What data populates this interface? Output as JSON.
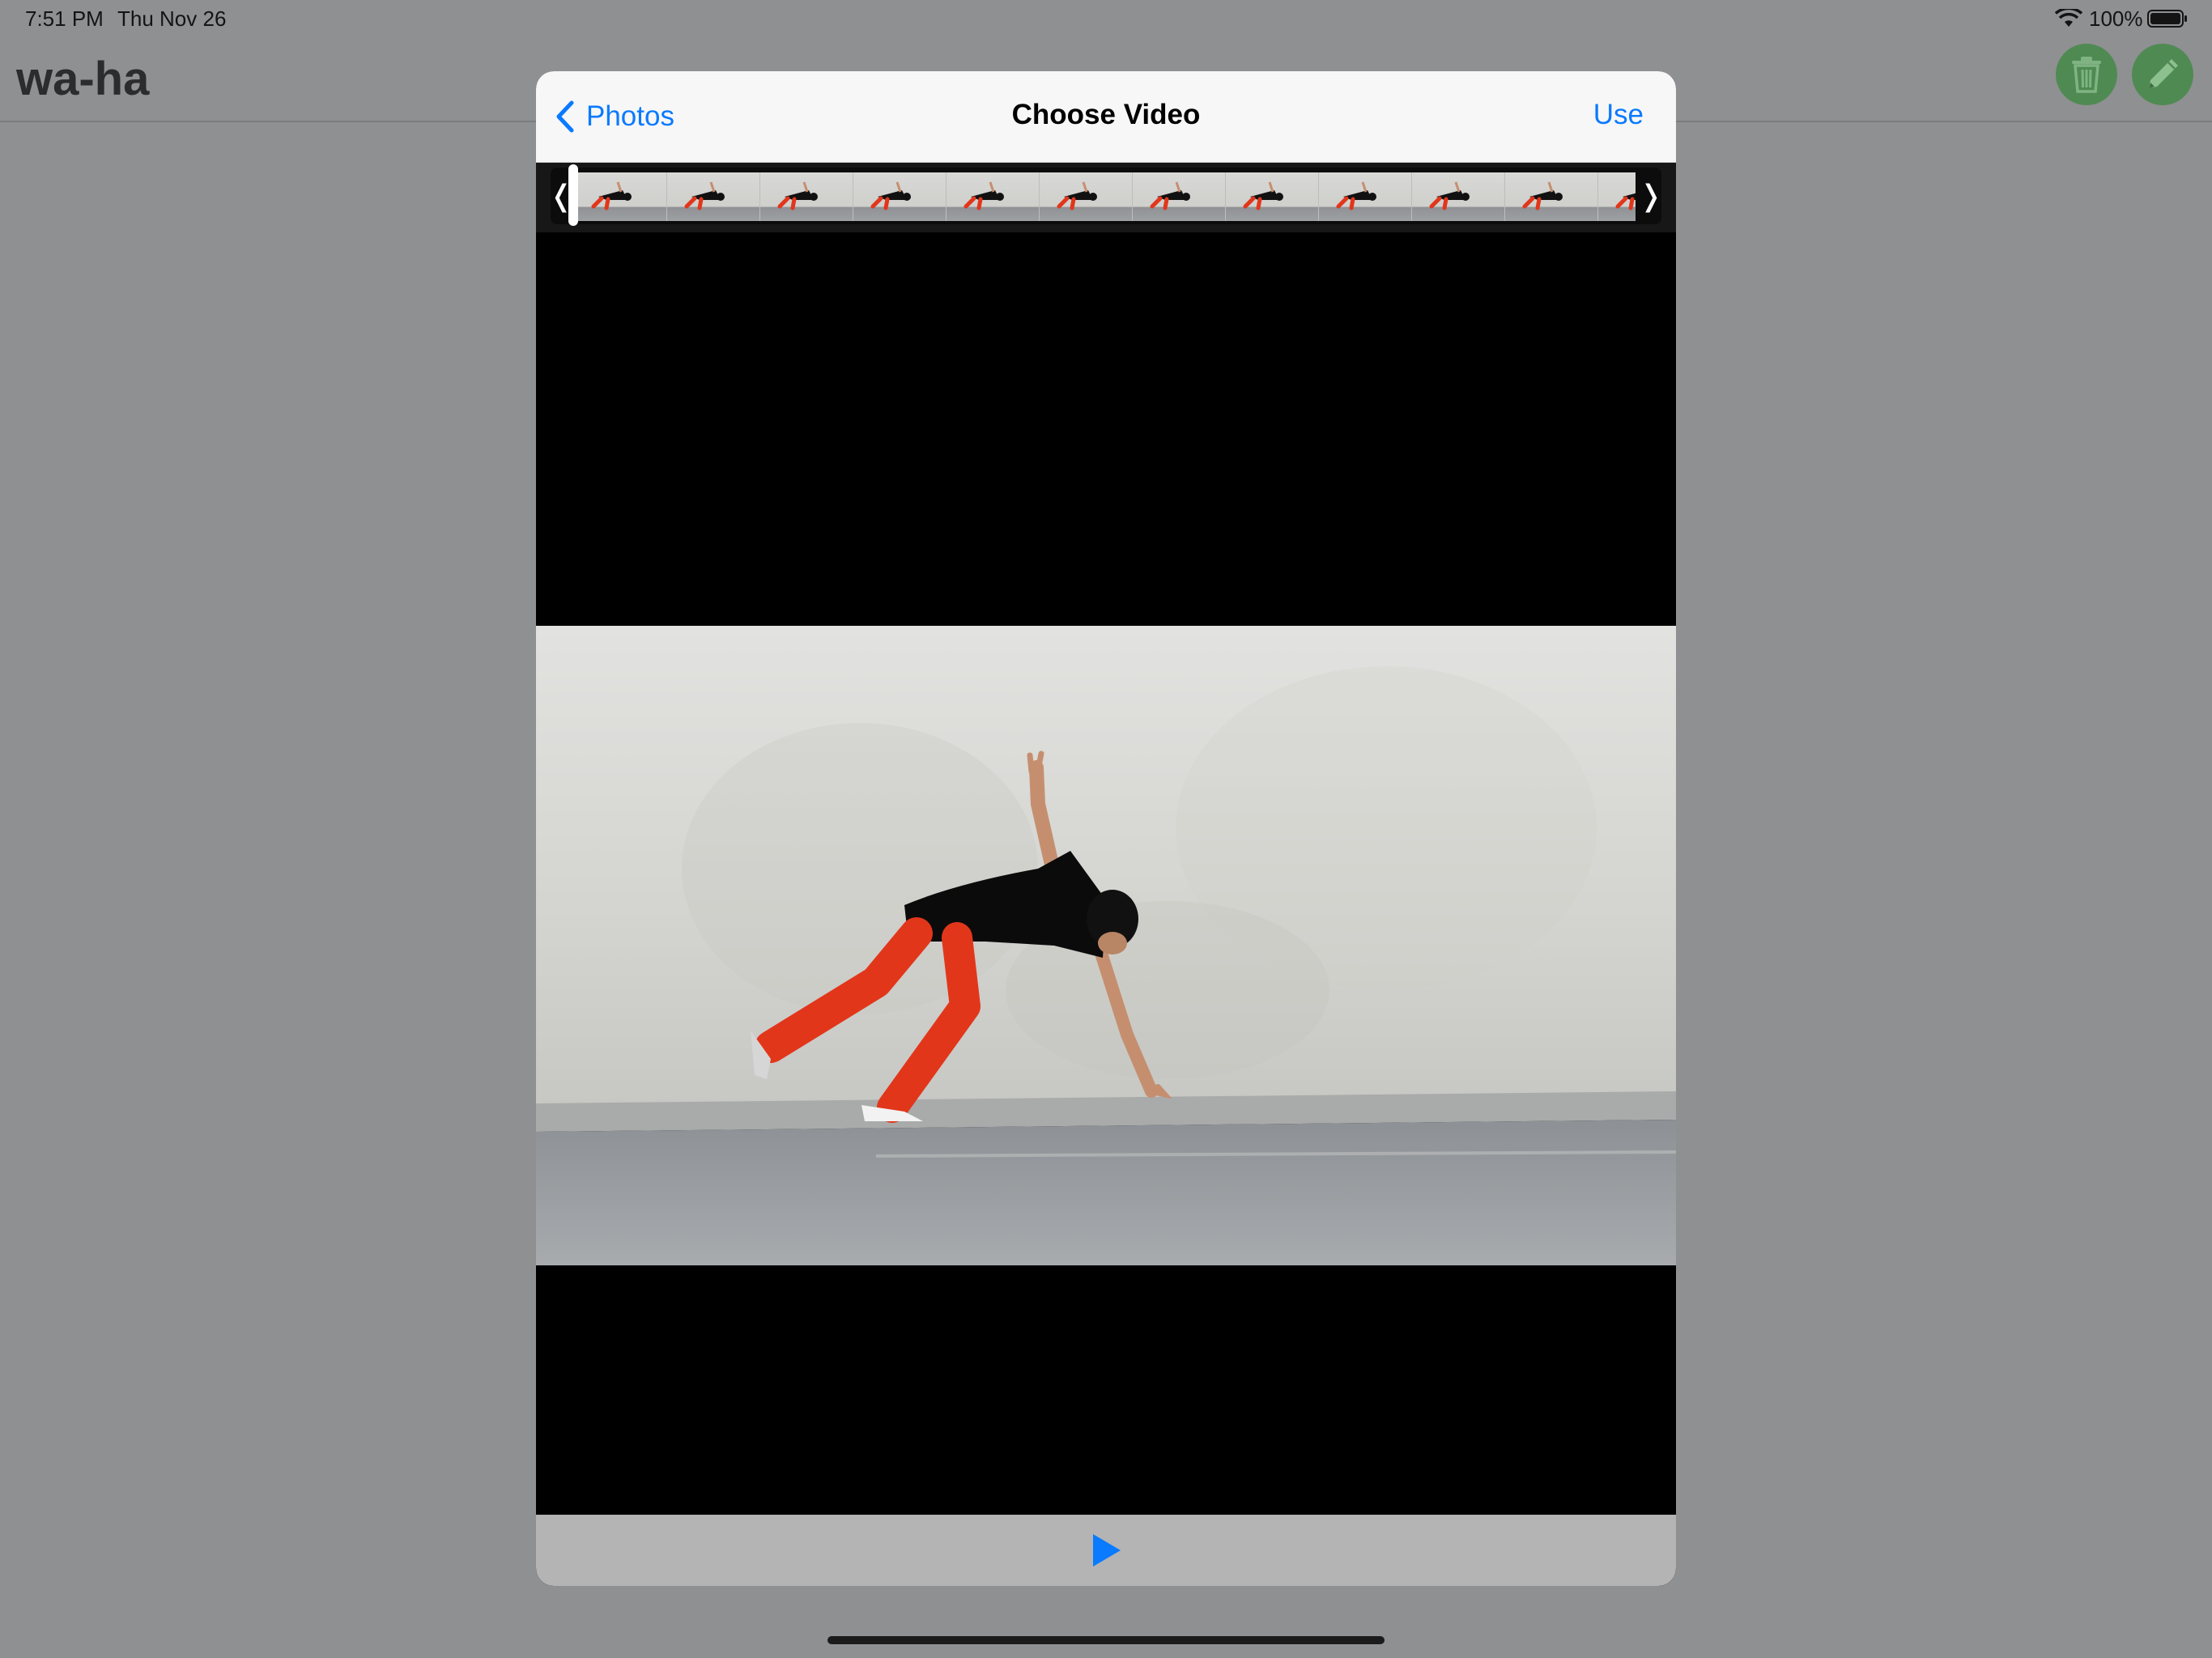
{
  "status_bar": {
    "time": "7:51 PM",
    "date": "Thu Nov 26",
    "battery_percent": "100%"
  },
  "app": {
    "title": "wa-ha",
    "accent_green": "#4f8a52"
  },
  "modal": {
    "back_label": "Photos",
    "title": "Choose Video",
    "use_label": "Use"
  },
  "trimmer": {
    "left_handle": "❬",
    "right_handle": "❭",
    "thumbnail_count": 12
  },
  "colors": {
    "ios_blue": "#0a7aff",
    "video_background": "#000000"
  }
}
